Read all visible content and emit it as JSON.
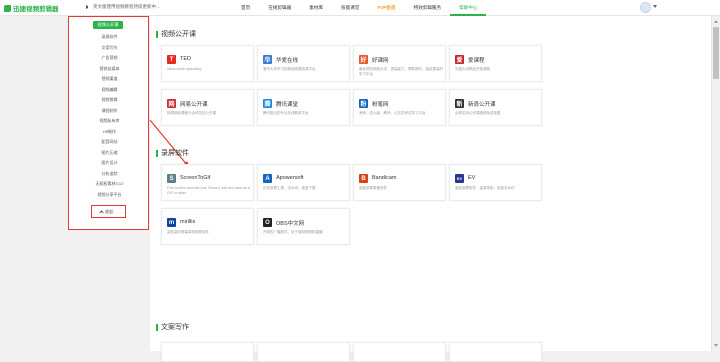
{
  "brand": {
    "name": "迅捷视频剪辑器"
  },
  "notice": "英文版使用视频教程持续更新中...",
  "nav": [
    {
      "label": "首页",
      "active": false,
      "vip": false
    },
    {
      "label": "在线剪辑器",
      "active": false,
      "vip": false
    },
    {
      "label": "素材库",
      "active": false,
      "vip": false
    },
    {
      "label": "技能课堂",
      "active": false,
      "vip": false
    },
    {
      "label": "FVP会员",
      "active": false,
      "vip": true
    },
    {
      "label": "特效剪辑服务",
      "active": false,
      "vip": false
    },
    {
      "label": "帮助中心",
      "active": true,
      "vip": false
    }
  ],
  "sidebar": {
    "heading": "视频公开课",
    "items": [
      "录屏软件",
      "文案写作",
      "广告营销",
      "营销自媒体",
      "营销渠道",
      "视频编辑",
      "视频剪辑",
      "课程制作",
      "视频私有库",
      "H5制作",
      "配音网站",
      "图片压缩",
      "图片设计",
      "分析追踪",
      "无版权素材CC0",
      "视频分享平台"
    ],
    "collapse": "收起"
  },
  "sections": [
    {
      "title": "视频公开课",
      "cards": [
        {
          "name": "TED",
          "desc": "Ideas worth spreading",
          "icon": "ted-icon",
          "color": "#e62b1e",
          "glyph": "T"
        },
        {
          "name": "华爱在线",
          "desc": "爱华大学学习的精品网课资源平台",
          "icon": "huaai-icon",
          "color": "#3a7bd5",
          "glyph": "华"
        },
        {
          "name": "好课网",
          "desc": "最优质的网络大学，提高能力，帮助提升，挑战更高的学习平台",
          "icon": "haoke-icon",
          "color": "#e8582c",
          "glyph": "好"
        },
        {
          "name": "爱课程",
          "desc": "中国大学精品开放课程",
          "icon": "aike-icon",
          "color": "#c62828",
          "glyph": "爱"
        },
        {
          "name": "网易公开课",
          "desc": "网易精品课程与全球名校公开课",
          "icon": "netease-icon",
          "color": "#d32f2f",
          "glyph": "网"
        },
        {
          "name": "腾讯课堂",
          "desc": "腾讯推出的专业在线教育平台",
          "icon": "tencent-ke-icon",
          "color": "#1e88e5",
          "glyph": "腾"
        },
        {
          "name": "粉笔网",
          "desc": "考研、四六级、教师、公务员考试学习平台",
          "icon": "fenbi-icon",
          "color": "#1565c0",
          "glyph": "粉"
        },
        {
          "name": "新浪公开课",
          "desc": "全球名校公开课视频免费观看",
          "icon": "sina-icon",
          "color": "#333333",
          "glyph": "新"
        }
      ]
    },
    {
      "title": "录屏软件",
      "cards": [
        {
          "name": "ScreenToGif",
          "desc": "Free screen recorder tool. Record, edit and save as a GIF or video",
          "icon": "screentogif-icon",
          "color": "#607d8b",
          "glyph": "S"
        },
        {
          "name": "Apowersoft",
          "desc": "在线录屏工具，无水印，免费下载",
          "icon": "apowersoft-icon",
          "color": "#1565c0",
          "glyph": "A"
        },
        {
          "name": "Bandicam",
          "desc": "电脑录屏录像软件",
          "icon": "bandicam-icon",
          "color": "#d84315",
          "glyph": "B"
        },
        {
          "name": "EV",
          "desc": "桌面录屏软件，高清录制，免费无水印",
          "icon": "ev-icon",
          "color": "#283593",
          "glyph": "EV"
        },
        {
          "name": "mirillis",
          "desc": "高性能的屏幕录制视频软件",
          "icon": "mirillis-icon",
          "color": "#0d47a1",
          "glyph": "m"
        },
        {
          "name": "OBS中文网",
          "desc": "开源的广播软件，用于录制视频和直播",
          "icon": "obs-icon",
          "color": "#222222",
          "glyph": "O"
        }
      ]
    },
    {
      "title": "文案写作",
      "cards": []
    }
  ]
}
